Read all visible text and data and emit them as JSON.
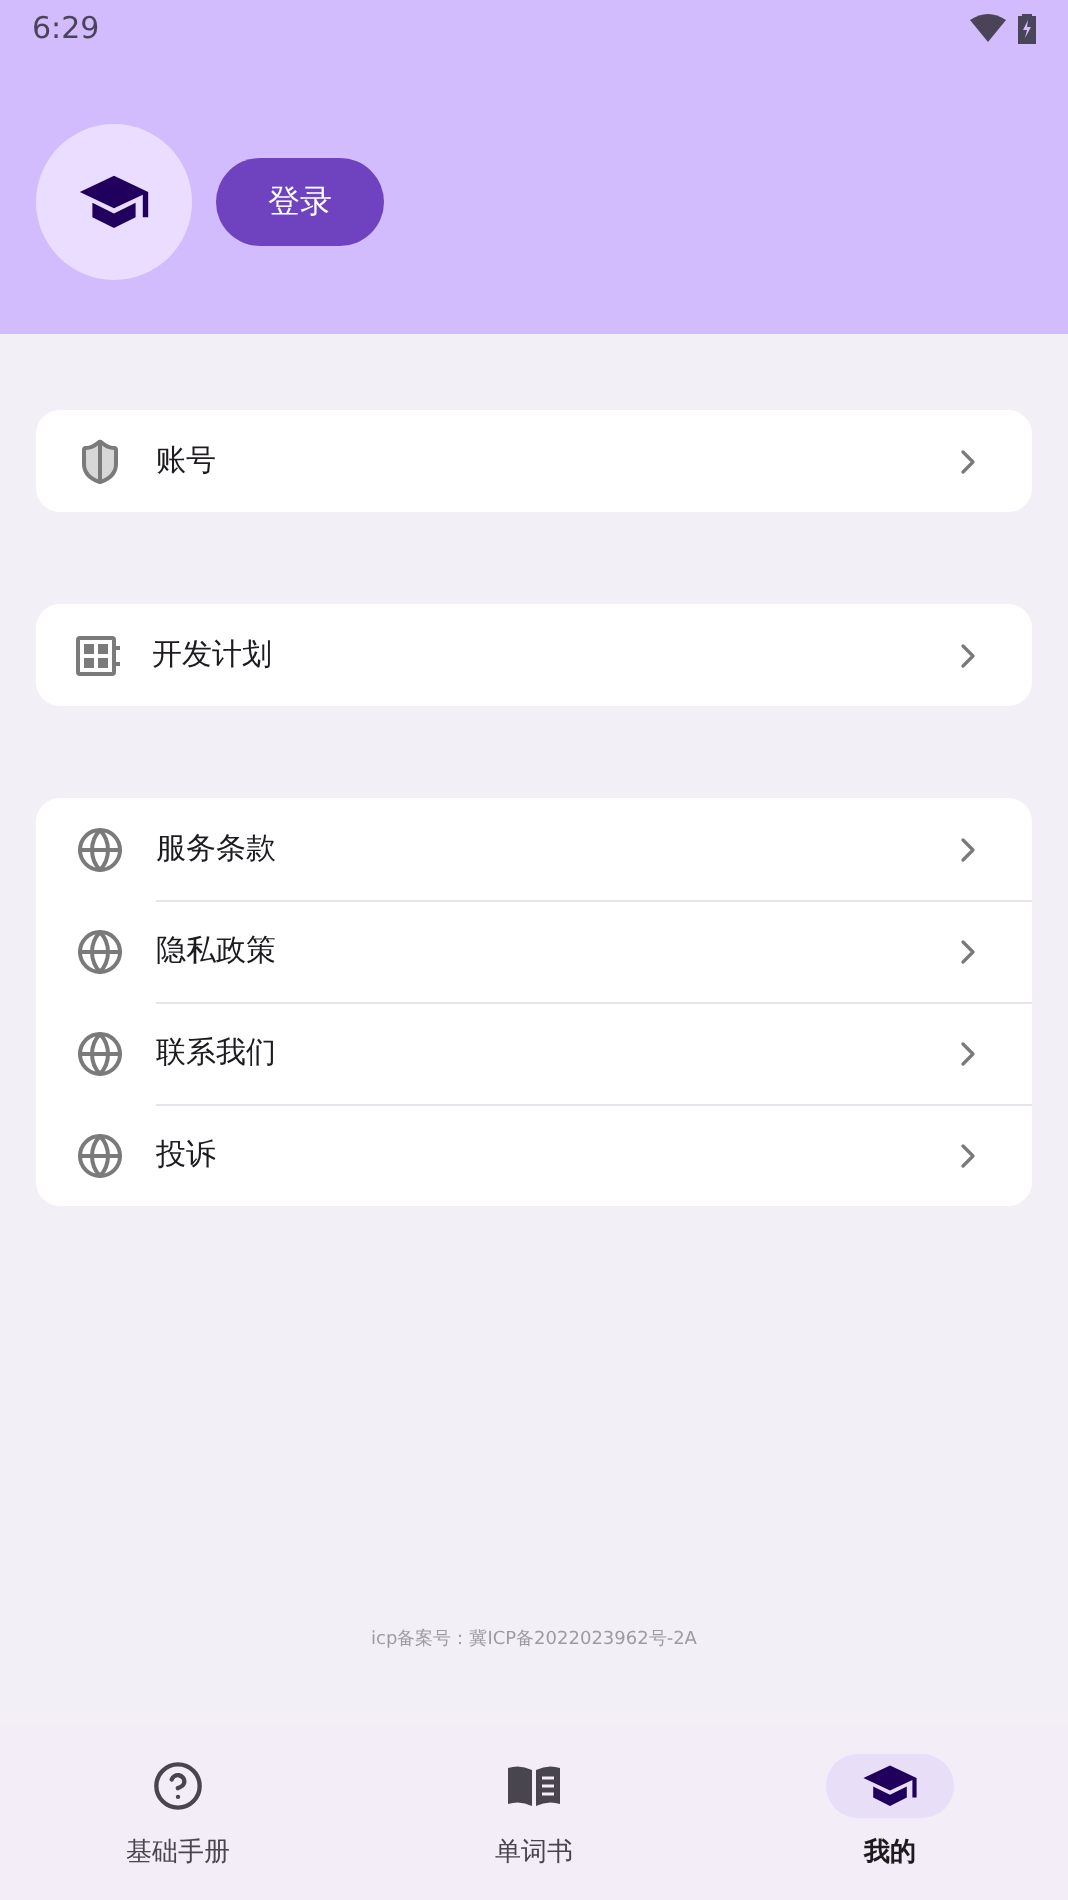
{
  "status_bar": {
    "time": "6:29"
  },
  "profile": {
    "login_button": "登录"
  },
  "sections": [
    {
      "items": [
        {
          "kind": "shield",
          "label": "账号"
        }
      ]
    },
    {
      "items": [
        {
          "kind": "plan",
          "label": "开发计划"
        }
      ]
    },
    {
      "items": [
        {
          "kind": "globe",
          "label": "服务条款"
        },
        {
          "kind": "globe",
          "label": "隐私政策"
        },
        {
          "kind": "globe",
          "label": "联系我们"
        },
        {
          "kind": "globe",
          "label": "投诉"
        }
      ]
    }
  ],
  "footer": {
    "icp": "icp备案号：冀ICP备2022023962号-2A"
  },
  "nav": [
    {
      "kind": "help",
      "label": "基础手册",
      "selected": false
    },
    {
      "kind": "book",
      "label": "单词书",
      "selected": false
    },
    {
      "kind": "cap",
      "label": "我的",
      "selected": true
    }
  ]
}
